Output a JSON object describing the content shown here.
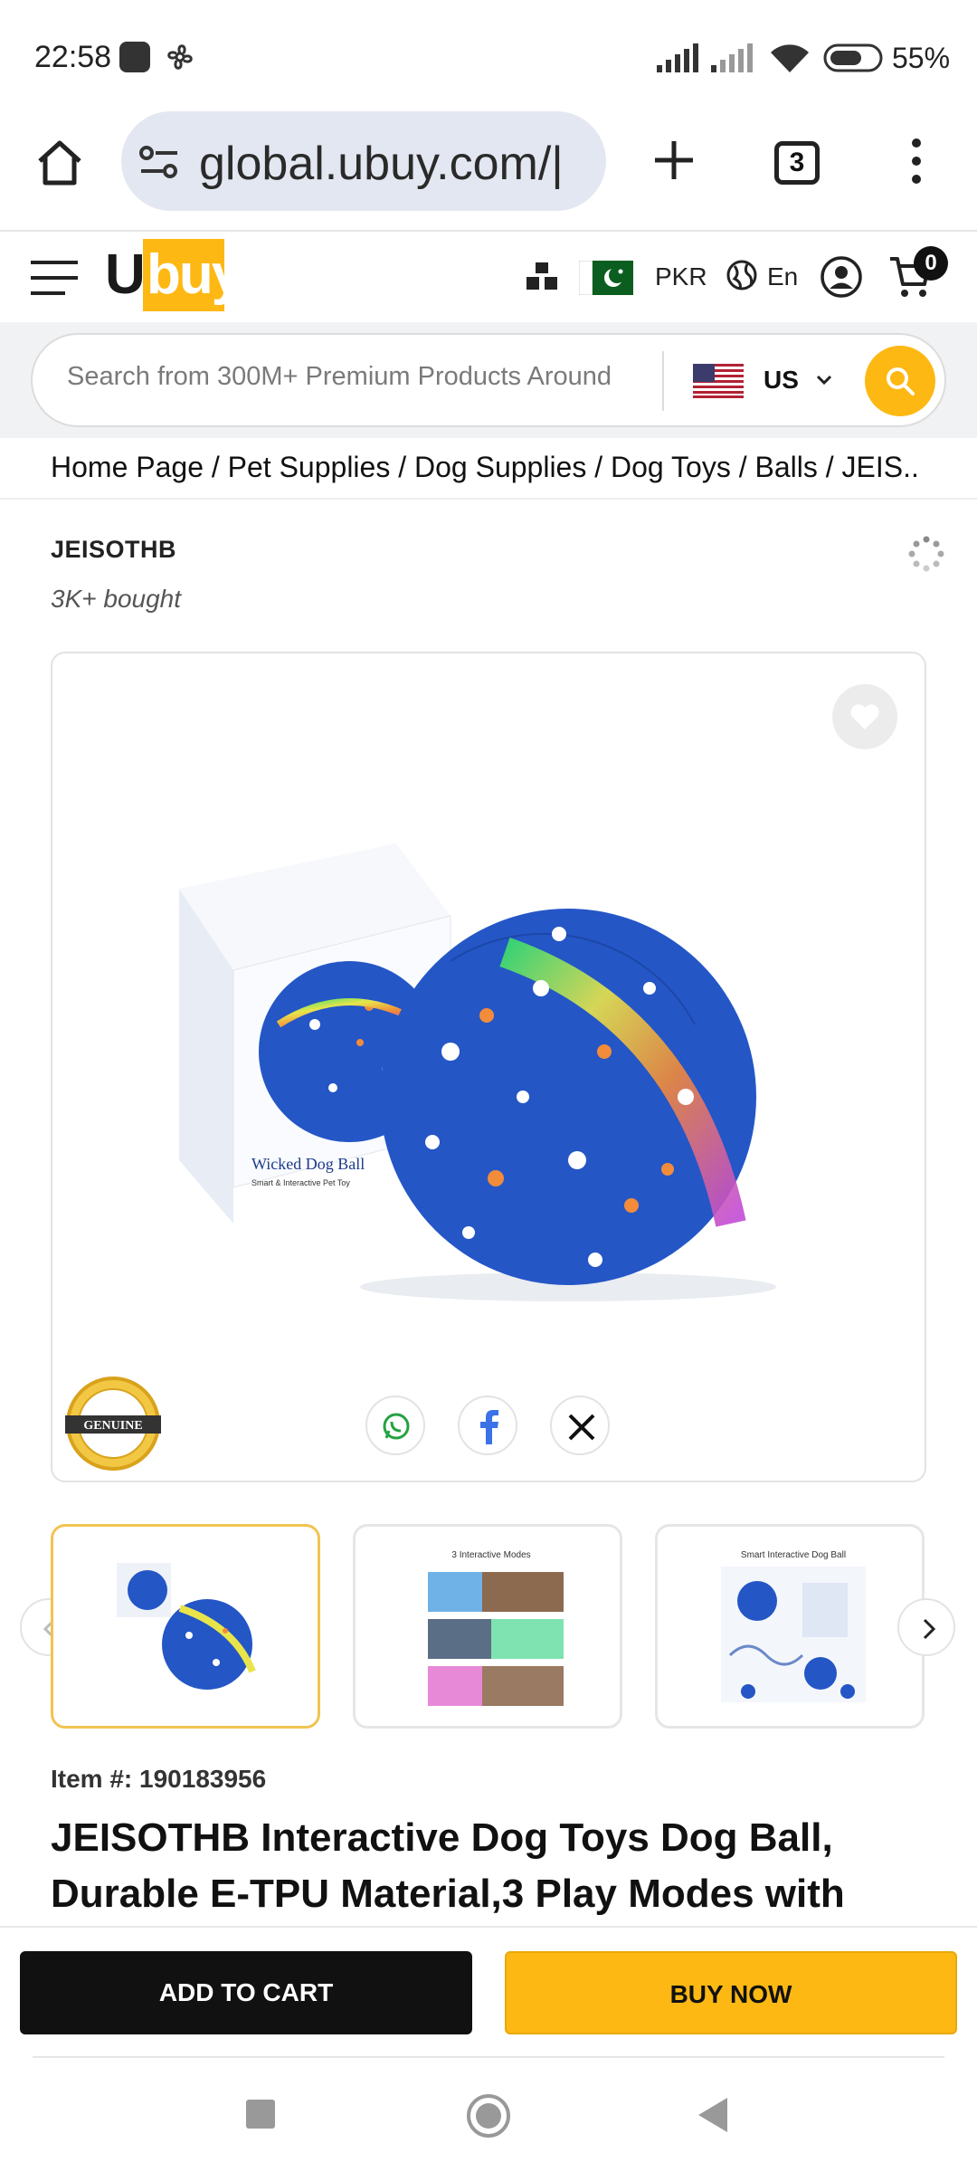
{
  "status_bar": {
    "time": "22:58",
    "battery": "55%"
  },
  "browser": {
    "url": "global.ubuy.com/|",
    "tab_count": "3"
  },
  "header": {
    "logo_u": "U",
    "logo_rest": "buy",
    "currency": "PKR",
    "language": "En",
    "cart_count": "0"
  },
  "search": {
    "placeholder": "Search from 300M+ Premium Products Around",
    "country": "US"
  },
  "breadcrumb": "Home Page / Pet Supplies / Dog Supplies / Dog Toys / Balls / JEIS...",
  "product": {
    "brand": "JEISOTHB",
    "bought": "3K+ bought",
    "image_box_title": "Wicked Dog Ball",
    "image_box_subtitle": "Smart & Interactive Pet Toy",
    "badge_text": "GENUINE",
    "item_number": "Item #: 190183956",
    "title": "JEISOTHB Interactive Dog Toys Dog Ball, Durable E-TPU Material,3 Play Modes with",
    "thumb2_title": "3 Interactive Modes",
    "thumb3_title": "Smart Interactive Dog Ball"
  },
  "actions": {
    "add_to_cart": "ADD TO CART",
    "buy_now": "BUY NOW"
  },
  "colors": {
    "brand_yellow": "#fdb813",
    "dark": "#111111",
    "ball_blue": "#2456c6"
  }
}
